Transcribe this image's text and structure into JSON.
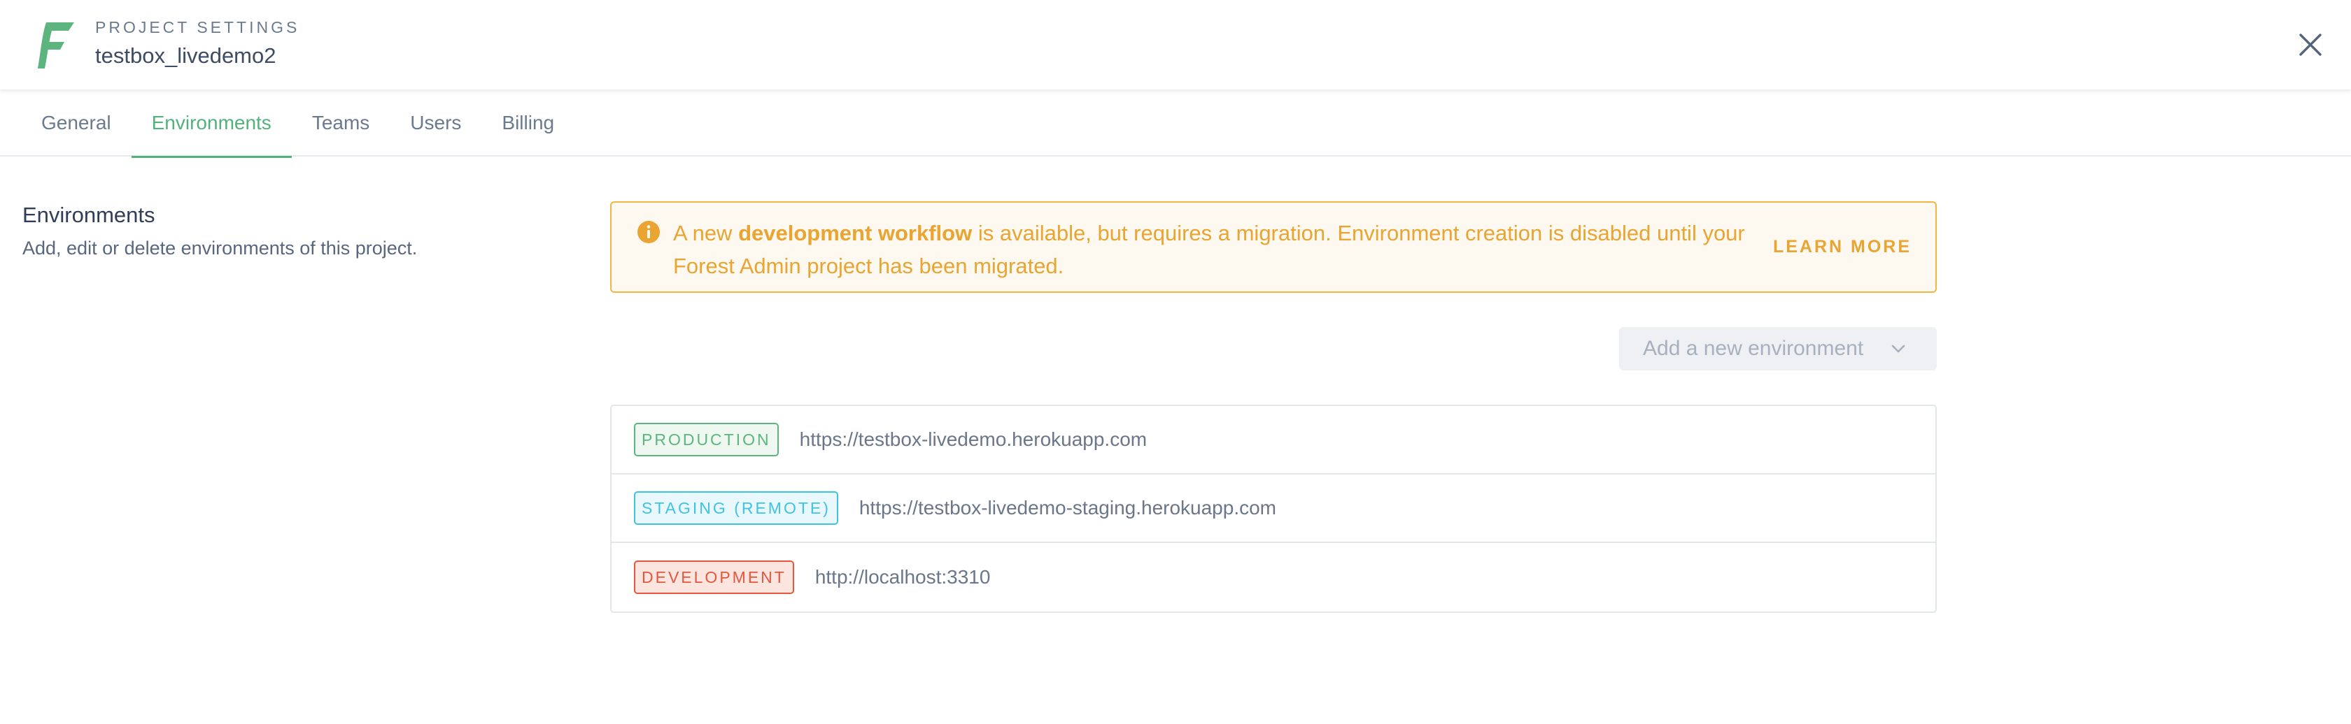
{
  "header": {
    "overline": "PROJECT SETTINGS",
    "project_name": "testbox_livedemo2",
    "logo_icon": "forest-admin-logo",
    "close_icon": "close-icon"
  },
  "tabs": [
    {
      "label": "General",
      "active": false
    },
    {
      "label": "Environments",
      "active": true
    },
    {
      "label": "Teams",
      "active": false
    },
    {
      "label": "Users",
      "active": false
    },
    {
      "label": "Billing",
      "active": false
    }
  ],
  "section": {
    "title": "Environments",
    "description": "Add, edit or delete environments of this project."
  },
  "notice": {
    "icon": "info-icon",
    "text_before": "A new ",
    "text_bold": "development workflow",
    "text_after": " is available, but requires a migration. Environment creation is disabled until your Forest Admin project has been migrated.",
    "action_label": "LEARN MORE"
  },
  "add_environment": {
    "label": "Add a new environment",
    "disabled": true,
    "icon": "chevron-down-icon"
  },
  "environments": [
    {
      "badge": "PRODUCTION",
      "url": "https://testbox-livedemo.herokuapp.com",
      "badge_color": "#5cb57f",
      "badge_bg": "#eef8f1"
    },
    {
      "badge": "STAGING (REMOTE)",
      "url": "https://testbox-livedemo-staging.herokuapp.com",
      "badge_color": "#3fc3e3",
      "badge_bg": "#e9f8fc"
    },
    {
      "badge": "DEVELOPMENT",
      "url": "http://localhost:3310",
      "badge_color": "#e4573e",
      "badge_bg": "#fce5df"
    }
  ],
  "colors": {
    "accent": "#53b27a",
    "warning": "#e9a431",
    "warning_border": "#f3b642",
    "warning_bg": "#fef9f0"
  }
}
